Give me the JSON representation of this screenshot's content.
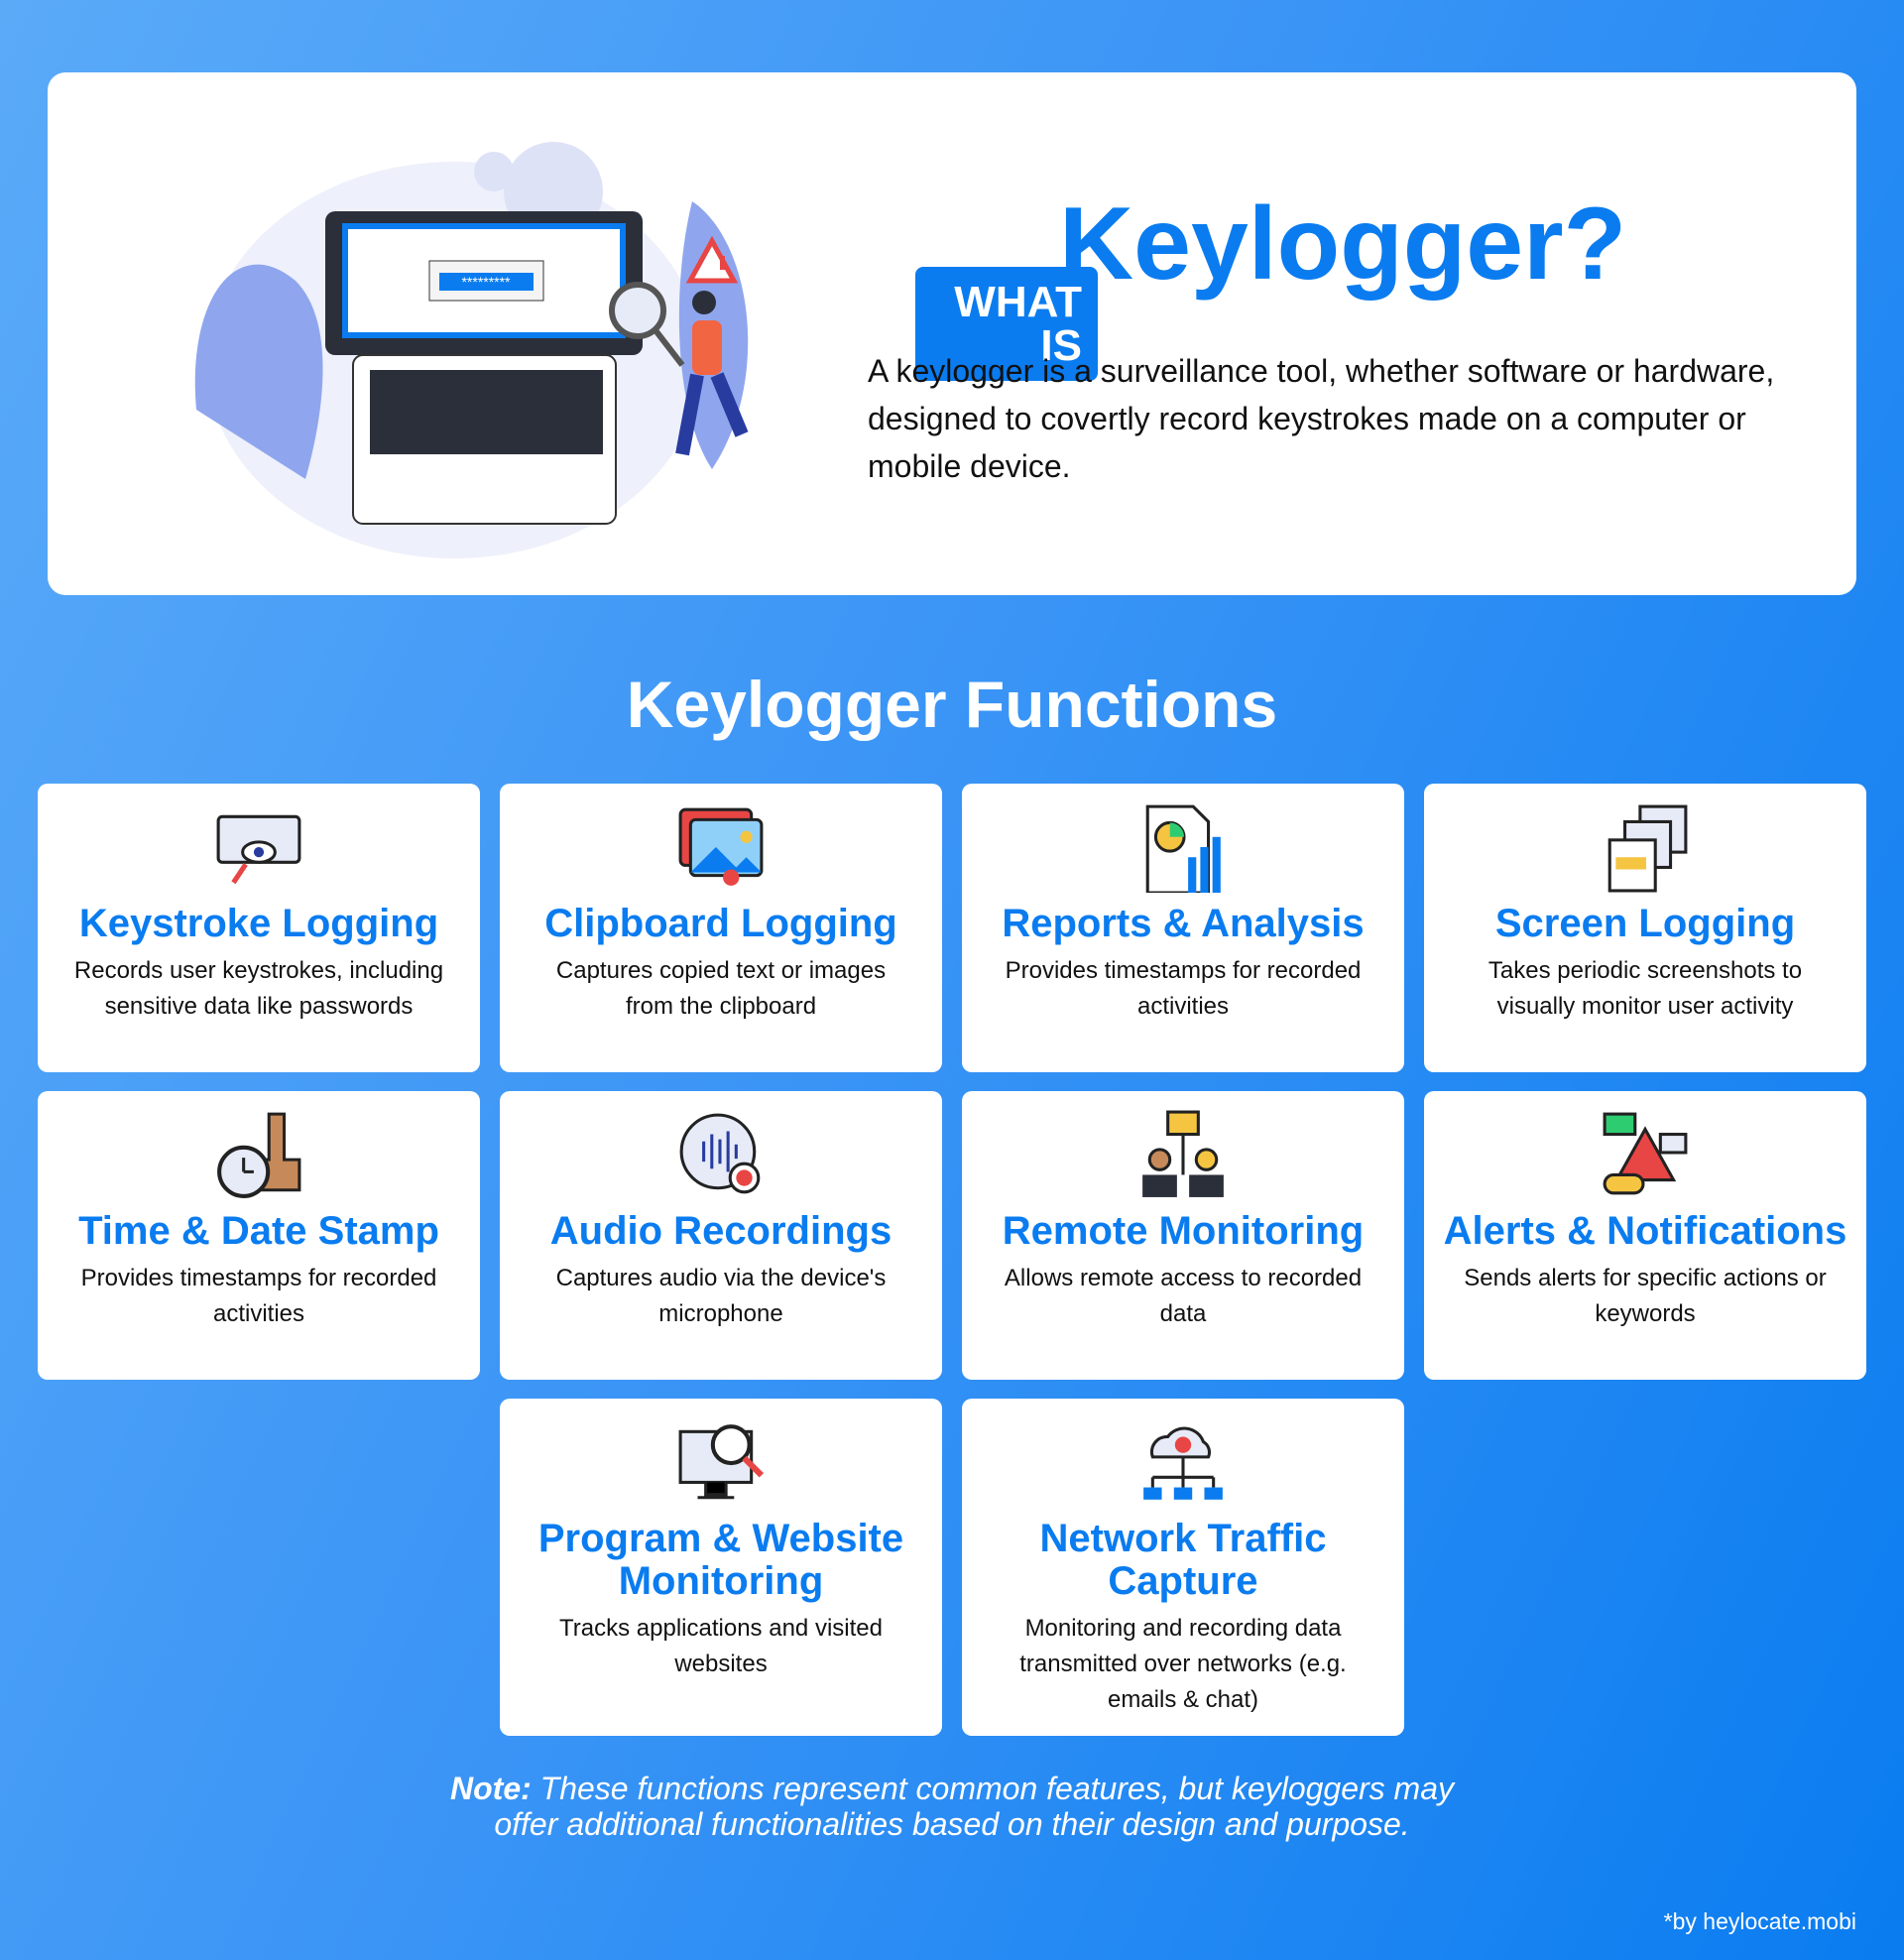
{
  "hero": {
    "badge_line1": "WHAT",
    "badge_line2": "IS",
    "title": "Keylogger?",
    "description": "A keylogger is a surveillance tool, whether software or hardware, designed to covertly record keystrokes made on a computer or mobile device.",
    "password_mask": "*********"
  },
  "section_heading": "Keylogger Functions",
  "functions": [
    {
      "title": "Keystroke Logging",
      "description": "Records user keystrokes, including sensitive data like passwords",
      "icon": "keyboard-eye-icon"
    },
    {
      "title": "Clipboard Logging",
      "description": "Captures copied text or images from the clipboard",
      "icon": "images-icon"
    },
    {
      "title": "Reports & Analysis",
      "description": "Provides timestamps for recorded activities",
      "icon": "report-chart-icon"
    },
    {
      "title": "Screen Logging",
      "description": "Takes periodic screenshots to visually monitor user activity",
      "icon": "screens-icon"
    },
    {
      "title": "Time & Date Stamp",
      "description": "Provides timestamps for recorded activities",
      "icon": "clock-stamp-icon"
    },
    {
      "title": "Audio Recordings",
      "description": "Captures audio via the device's microphone",
      "icon": "audio-record-icon"
    },
    {
      "title": "Remote Monitoring",
      "description": "Allows remote access to recorded data",
      "icon": "remote-users-icon"
    },
    {
      "title": "Alerts & Notifications",
      "description": "Sends alerts for specific actions or keywords",
      "icon": "alert-icon"
    },
    {
      "title": "Program & Website Monitoring",
      "description": "Tracks applications and visited websites",
      "icon": "monitor-search-icon"
    },
    {
      "title": "Network Traffic Capture",
      "description": "Monitoring and recording data transmitted over networks (e.g. emails & chat)",
      "icon": "cloud-network-icon"
    }
  ],
  "note": {
    "label": "Note:",
    "text": " These functions represent common features, but keyloggers may offer additional functionalities based on their design and purpose."
  },
  "credit": "*by heylocate.mobi",
  "colors": {
    "accent": "#0a7cf0",
    "background_start": "#5aaaf8",
    "background_end": "#0a7cf0"
  }
}
